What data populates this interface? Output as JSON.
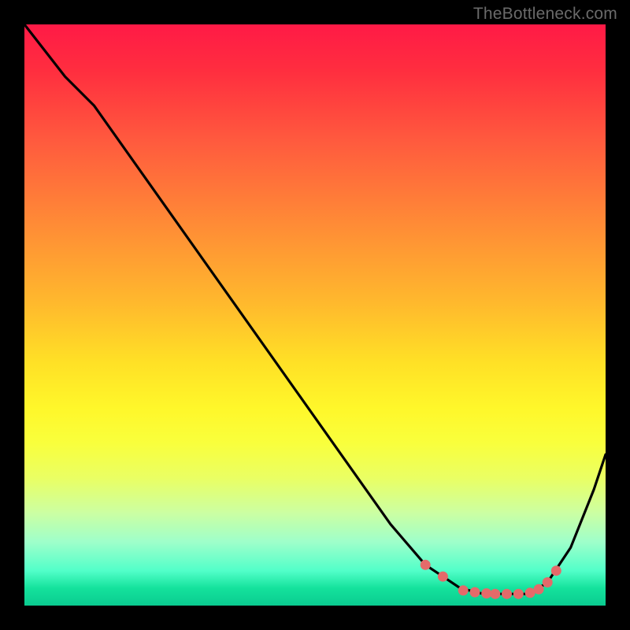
{
  "watermark": "TheBottleneck.com",
  "chart_data": {
    "type": "line",
    "title": "",
    "xlabel": "",
    "ylabel": "",
    "xlim": [
      0,
      100
    ],
    "ylim": [
      0,
      100
    ],
    "series": [
      {
        "name": "curve",
        "x": [
          0,
          7,
          12,
          63,
          69,
          72,
          75,
          79,
          83,
          87,
          90,
          94,
          98,
          100
        ],
        "y": [
          100,
          91,
          86,
          14,
          7,
          5,
          3,
          2,
          2,
          2,
          4,
          10,
          20,
          26
        ]
      }
    ],
    "markers": {
      "name": "dots",
      "color": "#e46a6a",
      "x": [
        69,
        72,
        75.5,
        77.5,
        79.5,
        81,
        83,
        85,
        87,
        88.5,
        90,
        91.5
      ],
      "y": [
        7,
        5,
        2.6,
        2.3,
        2.1,
        2.0,
        2.0,
        2.0,
        2.2,
        2.8,
        4.0,
        6.0
      ]
    },
    "background_gradient": {
      "top": "#ff1a46",
      "mid": "#fff72a",
      "bottom": "#0acb90"
    }
  }
}
